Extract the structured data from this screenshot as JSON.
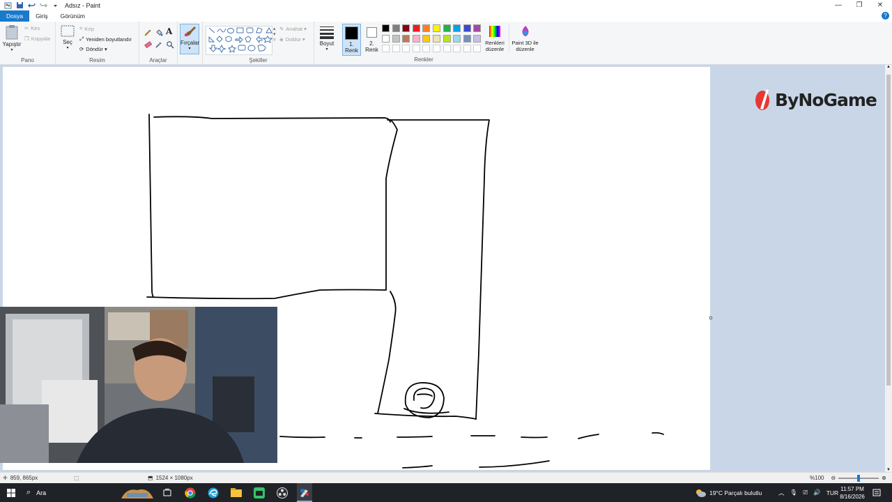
{
  "window": {
    "title": "Adsız - Paint",
    "minimize": "—",
    "maximize": "❐",
    "close": "✕"
  },
  "tabs": [
    "Dosya",
    "Giriş",
    "Görünüm"
  ],
  "ribbon": {
    "pano": {
      "label": "Pano",
      "paste": "Yapıştır",
      "cut": "Kes",
      "copy": "Kopyala"
    },
    "resim": {
      "label": "Resim",
      "select": "Seç",
      "crop": "Kırp",
      "resize": "Yeniden boyutlandır",
      "rotate": "Döndür ▾"
    },
    "araclar": {
      "label": "Araçlar",
      "text_tool": "A"
    },
    "brushes": {
      "label": "Fırçalar"
    },
    "sekiller": {
      "label": "Şekiller",
      "outline": "Anahat ▾",
      "fill": "Doldur ▾"
    },
    "size": {
      "label": "Boyut"
    },
    "color1": {
      "label": "1. Renk",
      "value": "#000000"
    },
    "color2": {
      "label": "2. Renk",
      "value": "#ffffff"
    },
    "renkler": {
      "label": "Renkler"
    },
    "edit_colors": "Renkleri düzenle",
    "paint3d": "Paint 3D ile düzenle",
    "palette_row1": [
      "#000000",
      "#7f7f7f",
      "#880015",
      "#ed1c24",
      "#ff7f27",
      "#fff200",
      "#22b14c",
      "#00a2e8",
      "#3f48cc",
      "#a349a4"
    ],
    "palette_row2": [
      "#ffffff",
      "#c3c3c3",
      "#b97a57",
      "#ffaec9",
      "#ffc90e",
      "#efe4b0",
      "#b5e61d",
      "#99d9ea",
      "#7092be",
      "#c8bfe7"
    ]
  },
  "watermark": {
    "text": "ByNoGame"
  },
  "status": {
    "cursor_pos": "859, 865px",
    "canvas_size": "1524 × 1080px",
    "zoom": "%100"
  },
  "taskbar": {
    "search": "Ara",
    "weather": "19°C  Parçalı bulutlu",
    "lang": "TUR",
    "time": "11:57 PM",
    "date": "8/16/2026"
  }
}
